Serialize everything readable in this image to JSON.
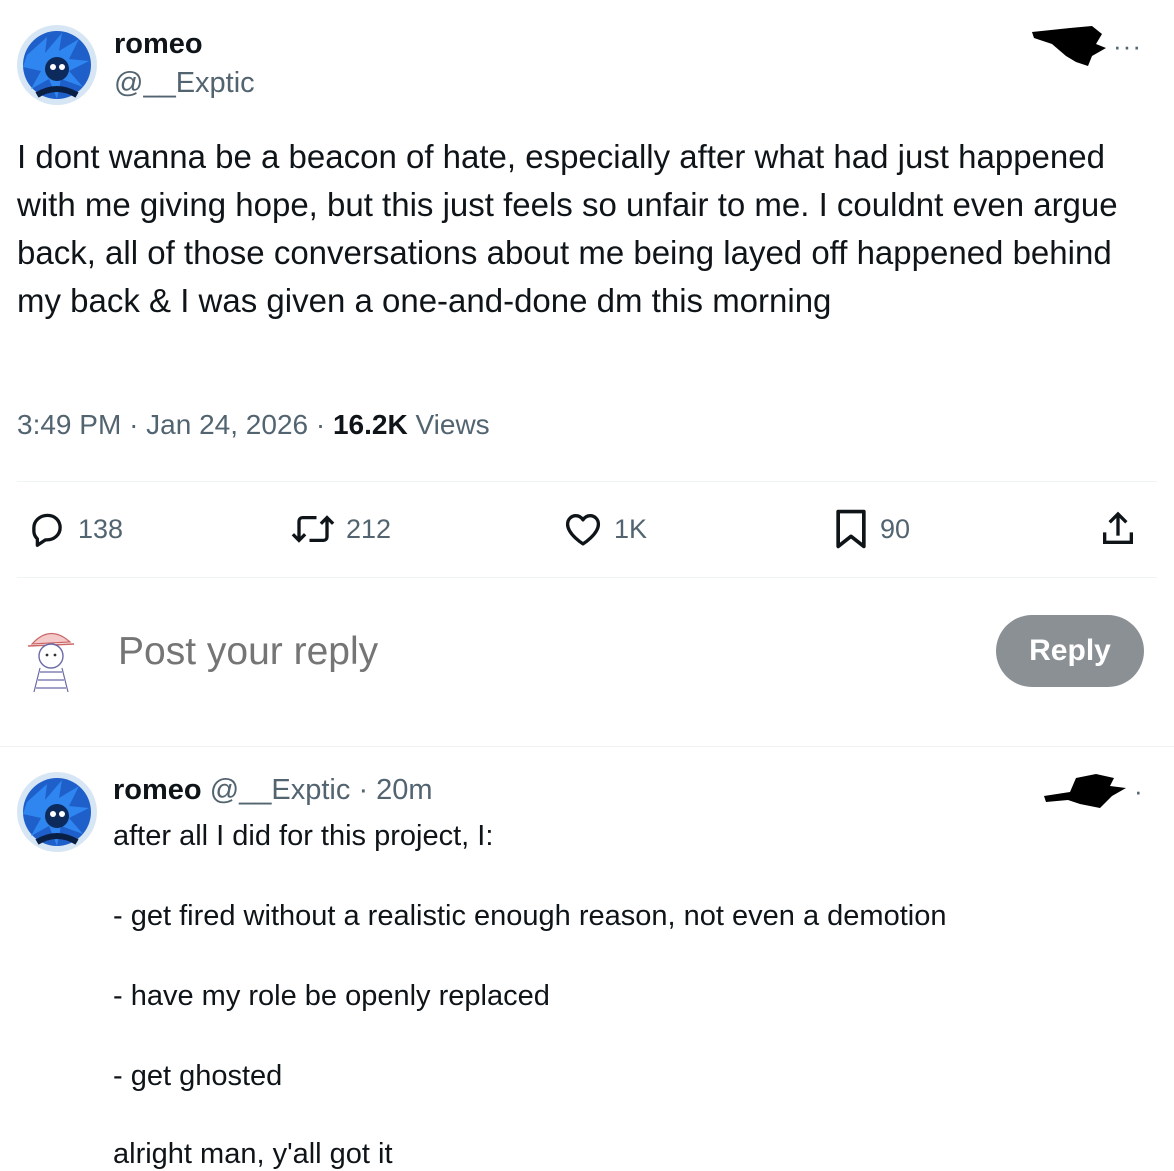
{
  "main_tweet": {
    "author_name": "romeo",
    "author_handle": "@__Exptic",
    "text": "I dont wanna be a beacon of hate, especially after what had just happened with me giving hope, but this just feels so unfair to me. I couldnt even argue back, all of those conversations about me being layed off happened behind my back & I was given a one-and-done dm this morning",
    "time": "3:49 PM",
    "date": "Jan 24, 2026",
    "views_count": "16.2K",
    "views_label": "Views",
    "separator": "·",
    "more_icon": "more-dots-icon"
  },
  "actions": {
    "replies": "138",
    "reposts": "212",
    "likes": "1K",
    "bookmarks": "90",
    "icons": [
      "reply-icon",
      "repost-icon",
      "like-icon",
      "bookmark-icon",
      "share-icon"
    ]
  },
  "composer": {
    "placeholder": "Post your reply",
    "button_label": "Reply"
  },
  "reply_tweet": {
    "author_name": "romeo",
    "author_handle": "@__Exptic",
    "separator": "·",
    "time_ago": "20m",
    "lines": [
      "after all I did for this project, I:",
      "- get fired without a realistic enough reason, not even a demotion",
      "- have my role be openly replaced",
      "- get ghosted",
      "alright man, y'all got it"
    ]
  },
  "colors": {
    "text_primary": "#0f1419",
    "text_secondary": "#536471",
    "divider": "#eff3f4",
    "reply_button_bg": "#8b9095",
    "avatar_blue": "#2a6fd6"
  }
}
